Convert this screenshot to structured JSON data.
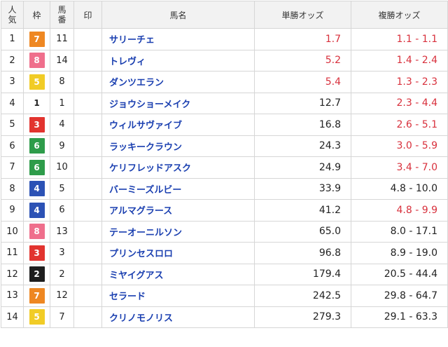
{
  "headers": {
    "popularity": [
      "人",
      "気"
    ],
    "waku": "枠",
    "umaban": [
      "馬",
      "番"
    ],
    "mark": "印",
    "horse": "馬名",
    "win": "単勝オッズ",
    "place": "複勝オッズ"
  },
  "colors": {
    "hot_odds": "#d8303c",
    "horse_name": "#1a3fb0",
    "waku": {
      "1": {
        "bg": "#ffffff",
        "fg": "#222222"
      },
      "2": {
        "bg": "#1e1e1e",
        "fg": "#ffffff"
      },
      "3": {
        "bg": "#e2342f",
        "fg": "#ffffff"
      },
      "4": {
        "bg": "#2c52b5",
        "fg": "#ffffff"
      },
      "5": {
        "bg": "#f1cc26",
        "fg": "#ffffff"
      },
      "6": {
        "bg": "#2e9c4a",
        "fg": "#ffffff"
      },
      "7": {
        "bg": "#ee8722",
        "fg": "#ffffff"
      },
      "8": {
        "bg": "#ef6f8c",
        "fg": "#ffffff"
      }
    }
  },
  "rows": [
    {
      "pop": "1",
      "waku": "7",
      "umaban": "11",
      "horse": "サリーチェ",
      "win": "1.7",
      "place": "1.1 - 1.1",
      "win_hot": true,
      "place_hot": true
    },
    {
      "pop": "2",
      "waku": "8",
      "umaban": "14",
      "horse": "トレヴィ",
      "win": "5.2",
      "place": "1.4 - 2.4",
      "win_hot": true,
      "place_hot": true
    },
    {
      "pop": "3",
      "waku": "5",
      "umaban": "8",
      "horse": "ダンツエラン",
      "win": "5.4",
      "place": "1.3 - 2.3",
      "win_hot": true,
      "place_hot": true
    },
    {
      "pop": "4",
      "waku": "1",
      "umaban": "1",
      "horse": "ジョウショーメイク",
      "win": "12.7",
      "place": "2.3 - 4.4",
      "win_hot": false,
      "place_hot": true
    },
    {
      "pop": "5",
      "waku": "3",
      "umaban": "4",
      "horse": "ウィルサヴァイブ",
      "win": "16.8",
      "place": "2.6 - 5.1",
      "win_hot": false,
      "place_hot": true
    },
    {
      "pop": "6",
      "waku": "6",
      "umaban": "9",
      "horse": "ラッキークラウン",
      "win": "24.3",
      "place": "3.0 - 5.9",
      "win_hot": false,
      "place_hot": true
    },
    {
      "pop": "7",
      "waku": "6",
      "umaban": "10",
      "horse": "ケリフレッドアスク",
      "win": "24.9",
      "place": "3.4 - 7.0",
      "win_hot": false,
      "place_hot": true
    },
    {
      "pop": "8",
      "waku": "4",
      "umaban": "5",
      "horse": "バーミーズルビー",
      "win": "33.9",
      "place": "4.8 - 10.0",
      "win_hot": false,
      "place_hot": false
    },
    {
      "pop": "9",
      "waku": "4",
      "umaban": "6",
      "horse": "アルマグラース",
      "win": "41.2",
      "place": "4.8 - 9.9",
      "win_hot": false,
      "place_hot": true
    },
    {
      "pop": "10",
      "waku": "8",
      "umaban": "13",
      "horse": "テーオーニルソン",
      "win": "65.0",
      "place": "8.0 - 17.1",
      "win_hot": false,
      "place_hot": false
    },
    {
      "pop": "11",
      "waku": "3",
      "umaban": "3",
      "horse": "プリンセスロロ",
      "win": "96.8",
      "place": "8.9 - 19.0",
      "win_hot": false,
      "place_hot": false
    },
    {
      "pop": "12",
      "waku": "2",
      "umaban": "2",
      "horse": "ミヤイグアス",
      "win": "179.4",
      "place": "20.5 - 44.4",
      "win_hot": false,
      "place_hot": false
    },
    {
      "pop": "13",
      "waku": "7",
      "umaban": "12",
      "horse": "セラード",
      "win": "242.5",
      "place": "29.8 - 64.7",
      "win_hot": false,
      "place_hot": false
    },
    {
      "pop": "14",
      "waku": "5",
      "umaban": "7",
      "horse": "クリノモノリス",
      "win": "279.3",
      "place": "29.1 - 63.3",
      "win_hot": false,
      "place_hot": false
    }
  ]
}
